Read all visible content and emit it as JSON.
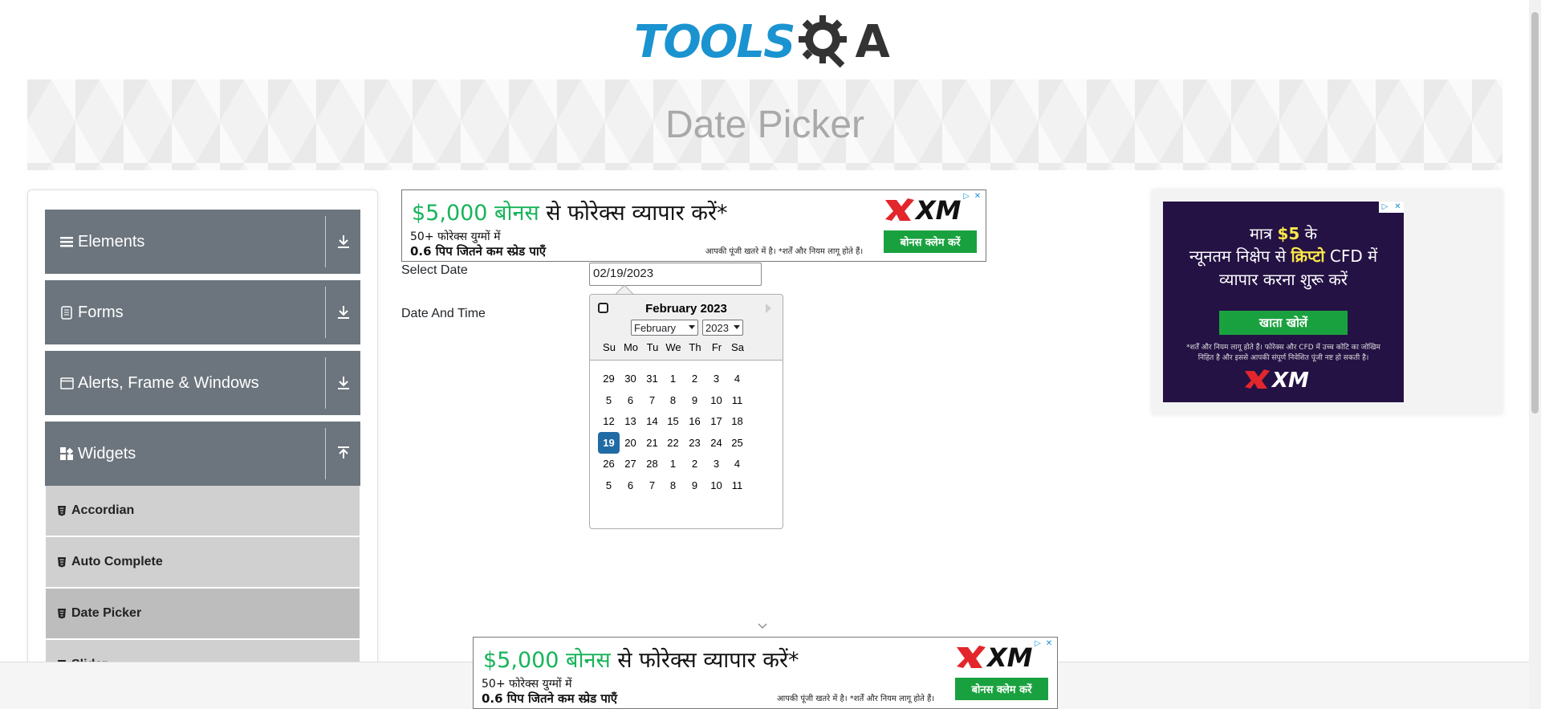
{
  "header": {
    "logo_text_left": "TOOLS",
    "logo_text_right": "A",
    "page_title": "Date Picker"
  },
  "sidebar": {
    "groups": [
      {
        "label": "Elements",
        "icon": "hamburger-icon",
        "expanded": false
      },
      {
        "label": "Forms",
        "icon": "document-icon",
        "expanded": false
      },
      {
        "label": "Alerts, Frame & Windows",
        "icon": "window-icon",
        "expanded": false
      },
      {
        "label": "Widgets",
        "icon": "widgets-grid-icon",
        "expanded": true
      }
    ],
    "sub_items": [
      {
        "label": "Accordian",
        "active": false
      },
      {
        "label": "Auto Complete",
        "active": false
      },
      {
        "label": "Date Picker",
        "active": true
      },
      {
        "label": "Slider",
        "active": false
      }
    ]
  },
  "ad_top": {
    "headline_green": "$5,000 बोनस",
    "headline_rest": " से फोरेक्स व्यापार करें*",
    "line2": "50+ फोरेक्स युग्मों में",
    "line3": "0.6 पिप जितने कम स्प्रेड पाएँ",
    "risk": "आपकी पूंजी खतरे में है। *शर्तें और नियम लागू होते हैं।",
    "brand": "XM",
    "cta": "बोनस क्लेम करें"
  },
  "ad_bottom": {
    "headline_green": "$5,000 बोनस",
    "headline_rest": " से फोरेक्स व्यापार करें*",
    "line2": "50+ फोरेक्स युग्मों में",
    "line3": "0.6 पिप जितने कम स्प्रेड पाएँ",
    "risk": "आपकी पूंजी खतरे में है। *शर्तें और नियम लागू होते हैं।",
    "brand": "XM",
    "cta": "बोनस क्लेम करें"
  },
  "form": {
    "select_date_label": "Select Date",
    "select_date_value": "02/19/2023",
    "date_time_label": "Date And Time"
  },
  "calendar": {
    "title": "February 2023",
    "month_select": "February",
    "year_select": "2023",
    "weekdays": [
      "Su",
      "Mo",
      "Tu",
      "We",
      "Th",
      "Fr",
      "Sa"
    ],
    "weeks": [
      [
        "29",
        "30",
        "31",
        "1",
        "2",
        "3",
        "4"
      ],
      [
        "5",
        "6",
        "7",
        "8",
        "9",
        "10",
        "11"
      ],
      [
        "12",
        "13",
        "14",
        "15",
        "16",
        "17",
        "18"
      ],
      [
        "19",
        "20",
        "21",
        "22",
        "23",
        "24",
        "25"
      ],
      [
        "26",
        "27",
        "28",
        "1",
        "2",
        "3",
        "4"
      ],
      [
        "5",
        "6",
        "7",
        "8",
        "9",
        "10",
        "11"
      ]
    ],
    "selected_day": "19"
  },
  "right_ad": {
    "line1_pre": "मात्र ",
    "line1_amount": "$5",
    "line1_post": " के",
    "line2_pre": "न्यूनतम निक्षेप से ",
    "line2_highlight": "क्रिप्टो",
    "line2_post": " CFD में",
    "line3": "व्यापार करना शुरू करें",
    "cta": "खाता खोलें",
    "fine_print": "*शर्तें और नियम लागू होते हैं। फोरेक्स और CFD में उच्च कोटि का जोखिम निहित है और इससे आपकी संपूर्ण निवेशित पूंजी नष्ट हो सकती है।",
    "brand": "XM"
  },
  "colors": {
    "logo_blue": "#1a93d0",
    "sidebar_group": "#6c757d",
    "sub_item": "#d0d0d0",
    "selected_day": "#216ba5",
    "ad_green": "#1aa13f",
    "right_ad_bg": "#241244"
  }
}
